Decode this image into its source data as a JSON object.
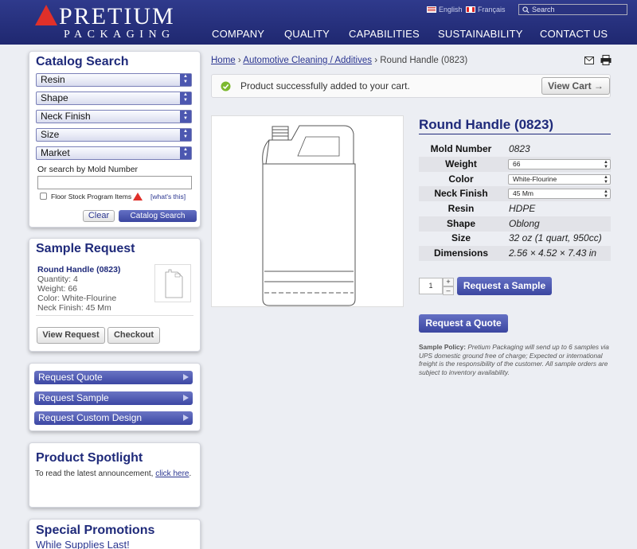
{
  "header": {
    "brand_line1": "PRETIUM",
    "brand_line2": "PACKAGING",
    "lang_en": "English",
    "lang_fr": "Français",
    "search_placeholder": "Search",
    "nav": [
      "COMPANY",
      "QUALITY",
      "CAPABILITIES",
      "SUSTAINABILITY",
      "CONTACT US"
    ]
  },
  "catalog": {
    "title": "Catalog Search",
    "selects": [
      "Resin",
      "Shape",
      "Neck Finish",
      "Size",
      "Market"
    ],
    "mold_label": "Or search by Mold Number",
    "mold_value": "",
    "floor_label": "Floor Stock Program Items",
    "whats_this": "[what's this]",
    "clear": "Clear",
    "search_btn": "Catalog Search"
  },
  "sample_request": {
    "title": "Sample Request",
    "item_name": "Round Handle (0823)",
    "lines": [
      "Quantity: 4",
      "Weight: 66",
      "Color: White-Flourine",
      "Neck Finish: 45 Mm"
    ],
    "view": "View Request",
    "checkout": "Checkout"
  },
  "quick_links": [
    "Request Quote",
    "Request Sample",
    "Request Custom Design"
  ],
  "spotlight": {
    "title": "Product Spotlight",
    "text": "To read the latest announcement,",
    "link": "click here",
    "period": "."
  },
  "promotions": {
    "title": "Special Promotions",
    "subtitle": "While Supplies Last!"
  },
  "breadcrumb": {
    "home": "Home",
    "sep1": " › ",
    "category": "Automotive Cleaning / Additives",
    "sep2": " › ",
    "current": "Round Handle (0823)"
  },
  "message": {
    "text": "Product successfully added to your cart.",
    "view_cart": "View Cart →"
  },
  "product": {
    "title": "Round Handle (0823)",
    "specs": [
      {
        "label": "Mold Number",
        "value": "0823"
      },
      {
        "label": "Weight",
        "value": "66"
      },
      {
        "label": "Color",
        "value": "White-Flourine"
      },
      {
        "label": "Neck Finish",
        "value": "45 Mm"
      },
      {
        "label": "Resin",
        "value": "HDPE"
      },
      {
        "label": "Shape",
        "value": "Oblong"
      },
      {
        "label": "Size",
        "value": "32 oz (1 quart, 950cc)"
      },
      {
        "label": "Dimensions",
        "value": "2.56 × 4.52 × 7.43 in"
      }
    ],
    "qty": "1",
    "request_sample": "Request a Sample",
    "request_quote": "Request a Quote",
    "policy_label": "Sample Policy:",
    "policy_text": " Pretium Packaging will send up to 6 samples via UPS domestic ground free of charge; Expected or international freight is the responsibility of the customer. All sample orders are subject to inventory availability."
  },
  "colors": {
    "brand_navy": "#1f2a7a",
    "header_bg": "#2a3380",
    "accent_red": "#e0302a",
    "success_green": "#7cb82f"
  }
}
